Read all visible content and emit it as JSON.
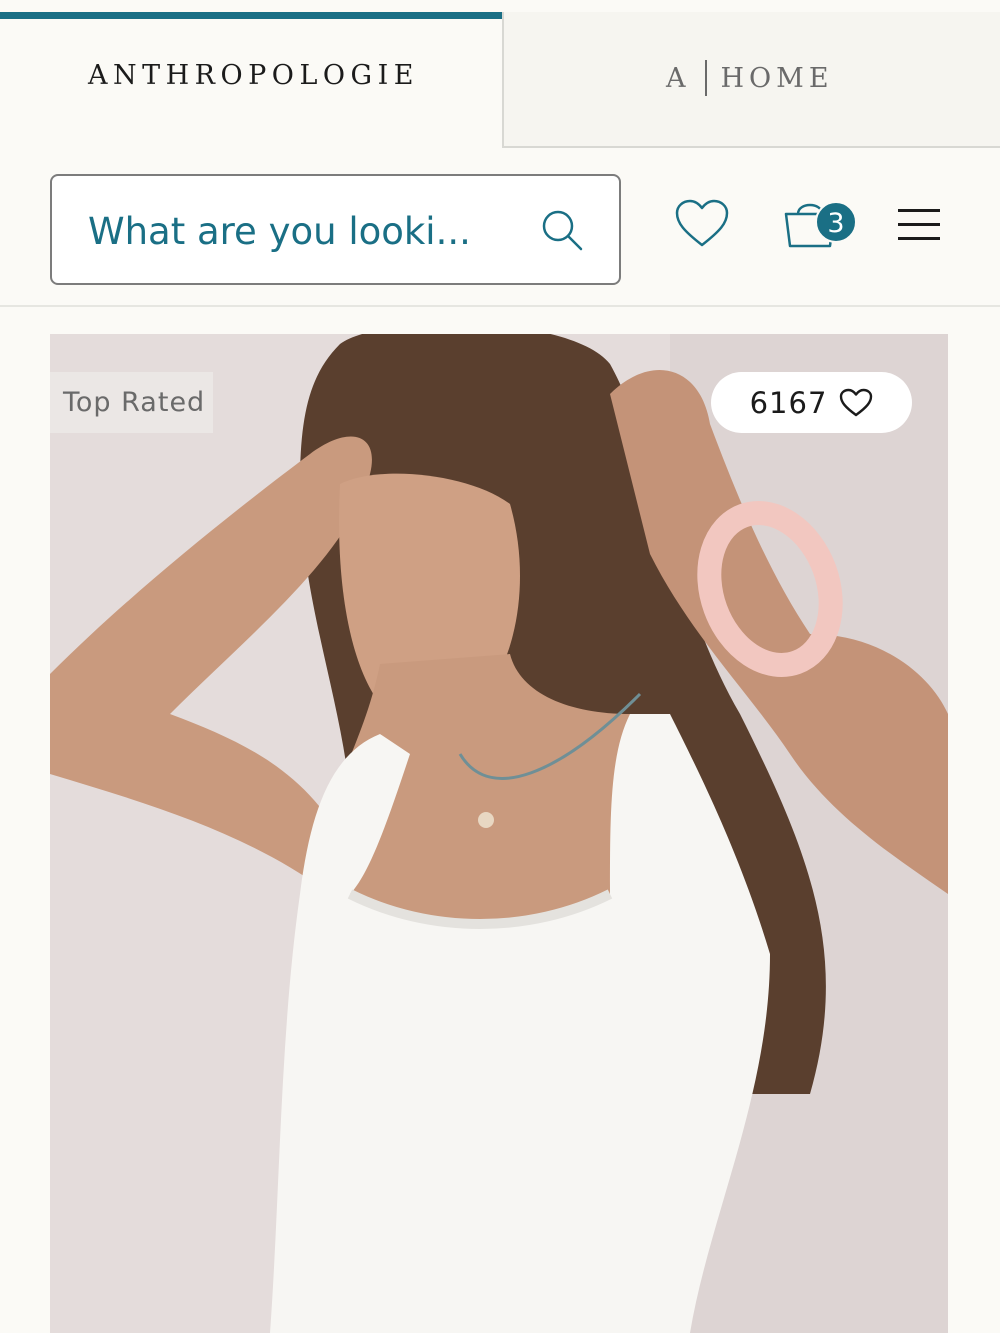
{
  "brand_tabs": {
    "active": "ANTHROPOLOGIE",
    "inactive_left": "A",
    "inactive_right": "HOME"
  },
  "header": {
    "search_placeholder": "What are you looki...",
    "icons": [
      "search-icon",
      "heart-icon",
      "shopping-bag-icon",
      "hamburger-menu-icon"
    ],
    "bag_count": "3"
  },
  "product": {
    "badge": "Top Rated",
    "likes": "6167"
  },
  "colors": {
    "accent": "#1a6f85",
    "background": "#fbfaf6"
  }
}
